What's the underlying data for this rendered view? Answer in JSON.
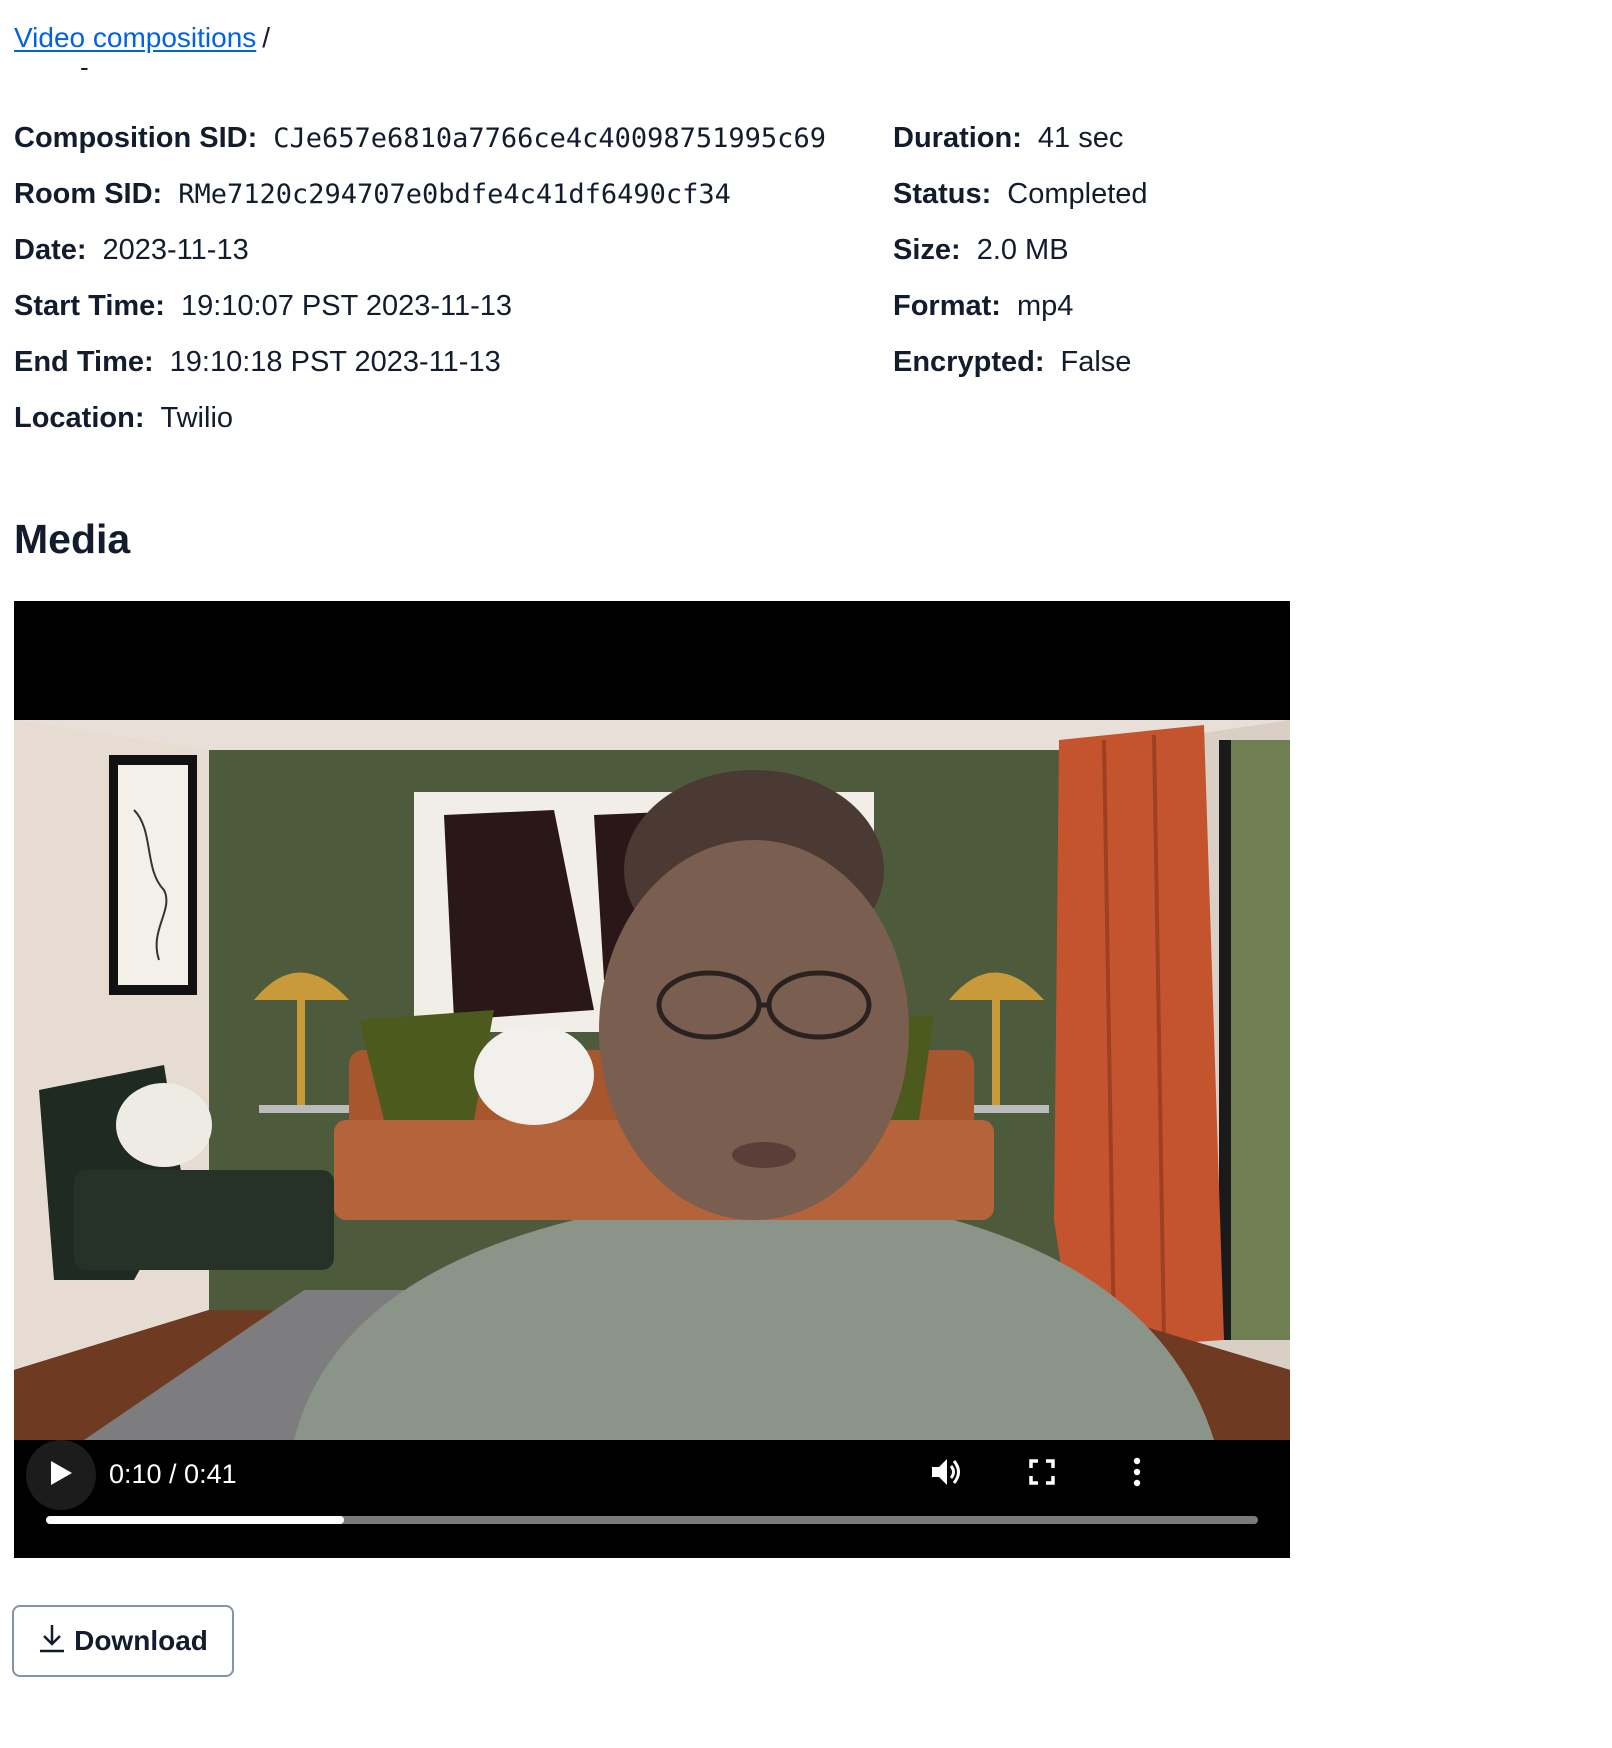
{
  "breadcrumb": {
    "link_label": "Video compositions",
    "separator": "/",
    "current": "-"
  },
  "details": {
    "left": [
      {
        "label": "Composition SID:",
        "value": "CJe657e6810a7766ce4c40098751995c69",
        "mono": true
      },
      {
        "label": "Room SID:",
        "value": "RMe7120c294707e0bdfe4c41df6490cf34",
        "mono": true
      },
      {
        "label": "Date:",
        "value": "2023-11-13"
      },
      {
        "label": "Start Time:",
        "value": "19:10:07 PST 2023-11-13"
      },
      {
        "label": "End Time:",
        "value": "19:10:18 PST 2023-11-13"
      },
      {
        "label": "Location:",
        "value": "Twilio"
      }
    ],
    "right": [
      {
        "label": "Duration:",
        "value": "41 sec"
      },
      {
        "label": "Status:",
        "value": "Completed"
      },
      {
        "label": "Size:",
        "value": "2.0 MB"
      },
      {
        "label": "Format:",
        "value": "mp4"
      },
      {
        "label": "Encrypted:",
        "value": "False"
      }
    ]
  },
  "media": {
    "heading": "Media",
    "player": {
      "current_time": "0:10",
      "duration": "0:41",
      "time_text": "0:10 / 0:41",
      "progress_fraction": 0.246,
      "icons": [
        "play-icon",
        "volume-icon",
        "fullscreen-icon",
        "more-options-icon"
      ]
    },
    "download_label": "Download"
  },
  "colors": {
    "link": "#0263e0",
    "text": "#121c2d",
    "button_border": "#8891aa",
    "player_bg": "#000000"
  }
}
